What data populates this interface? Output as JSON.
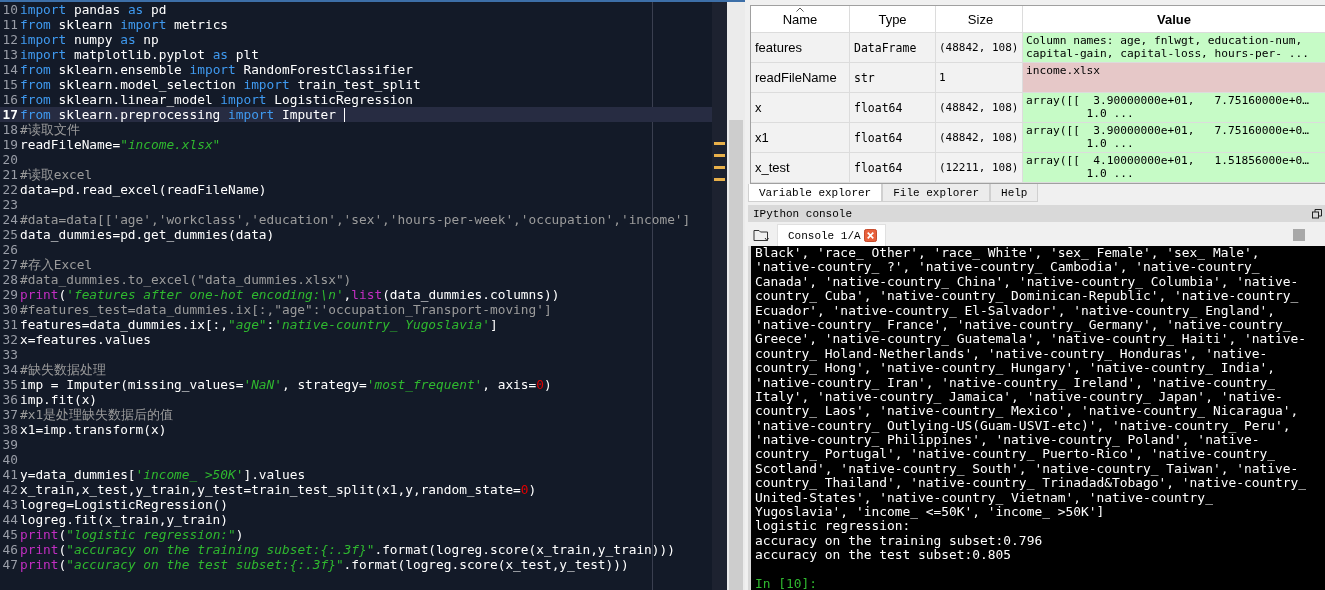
{
  "editor": {
    "lines": [
      {
        "number": "10",
        "current": false,
        "tokens": [
          {
            "kind": "keyword",
            "text": "import"
          },
          {
            "kind": "plain",
            "text": " pandas "
          },
          {
            "kind": "keyword",
            "text": "as"
          },
          {
            "kind": "plain",
            "text": " pd"
          }
        ]
      },
      {
        "number": "11",
        "current": false,
        "tokens": [
          {
            "kind": "keyword",
            "text": "from"
          },
          {
            "kind": "plain",
            "text": " sklearn "
          },
          {
            "kind": "keyword",
            "text": "import"
          },
          {
            "kind": "plain",
            "text": " metrics"
          }
        ]
      },
      {
        "number": "12",
        "current": false,
        "tokens": [
          {
            "kind": "keyword",
            "text": "import"
          },
          {
            "kind": "plain",
            "text": " numpy "
          },
          {
            "kind": "keyword",
            "text": "as"
          },
          {
            "kind": "plain",
            "text": " np"
          }
        ]
      },
      {
        "number": "13",
        "current": false,
        "tokens": [
          {
            "kind": "keyword",
            "text": "import"
          },
          {
            "kind": "plain",
            "text": " matplotlib.pyplot "
          },
          {
            "kind": "keyword",
            "text": "as"
          },
          {
            "kind": "plain",
            "text": " plt"
          }
        ]
      },
      {
        "number": "14",
        "current": false,
        "tokens": [
          {
            "kind": "keyword",
            "text": "from"
          },
          {
            "kind": "plain",
            "text": " sklearn.ensemble "
          },
          {
            "kind": "keyword",
            "text": "import"
          },
          {
            "kind": "plain",
            "text": " RandomForestClassifier"
          }
        ]
      },
      {
        "number": "15",
        "current": false,
        "tokens": [
          {
            "kind": "keyword",
            "text": "from"
          },
          {
            "kind": "plain",
            "text": " sklearn.model_selection "
          },
          {
            "kind": "keyword",
            "text": "import"
          },
          {
            "kind": "plain",
            "text": " train_test_split"
          }
        ]
      },
      {
        "number": "16",
        "current": false,
        "tokens": [
          {
            "kind": "keyword",
            "text": "from"
          },
          {
            "kind": "plain",
            "text": " sklearn.linear_model "
          },
          {
            "kind": "keyword",
            "text": "import"
          },
          {
            "kind": "plain",
            "text": " LogisticRegression"
          }
        ]
      },
      {
        "number": "17",
        "current": true,
        "tokens": [
          {
            "kind": "keyword",
            "text": "from"
          },
          {
            "kind": "plain",
            "text": " sklearn.preprocessing "
          },
          {
            "kind": "keyword",
            "text": "import"
          },
          {
            "kind": "plain",
            "text": " Imputer"
          }
        ]
      },
      {
        "number": "18",
        "current": false,
        "tokens": [
          {
            "kind": "comment",
            "text": "#读取文件"
          }
        ]
      },
      {
        "number": "19",
        "current": false,
        "tokens": [
          {
            "kind": "plain",
            "text": "readFileName="
          },
          {
            "kind": "string",
            "text": "\"income.xlsx\""
          }
        ]
      },
      {
        "number": "20",
        "current": false
      },
      {
        "number": "21",
        "current": false,
        "tokens": [
          {
            "kind": "comment",
            "text": "#读取excel"
          }
        ]
      },
      {
        "number": "22",
        "current": false,
        "tokens": [
          {
            "kind": "plain",
            "text": "data=pd.read_excel(readFileName)"
          }
        ]
      },
      {
        "number": "23",
        "current": false
      },
      {
        "number": "24",
        "current": false,
        "tokens": [
          {
            "kind": "comment",
            "text": "#data=data[['age','workclass','education','sex','hours-per-week','occupation','income']"
          }
        ]
      },
      {
        "number": "25",
        "current": false,
        "tokens": [
          {
            "kind": "plain",
            "text": "data_dummies=pd.get_dummies(data)"
          }
        ]
      },
      {
        "number": "26",
        "current": false
      },
      {
        "number": "27",
        "current": false,
        "tokens": [
          {
            "kind": "comment",
            "text": "#存入Excel"
          }
        ]
      },
      {
        "number": "28",
        "current": false,
        "tokens": [
          {
            "kind": "comment",
            "text": "#data_dummies.to_excel(\"data_dummies.xlsx\")"
          }
        ]
      },
      {
        "number": "29",
        "current": false,
        "tokens": [
          {
            "kind": "builtin",
            "text": "print"
          },
          {
            "kind": "plain",
            "text": "("
          },
          {
            "kind": "string",
            "text": "'features after one-hot encoding:\\n'"
          },
          {
            "kind": "plain",
            "text": ","
          },
          {
            "kind": "builtin",
            "text": "list"
          },
          {
            "kind": "plain",
            "text": "(data_dummies.columns))"
          }
        ]
      },
      {
        "number": "30",
        "current": false,
        "tokens": [
          {
            "kind": "comment",
            "text": "#features_test=data_dummies.ix[:,\"age\":'occupation_Transport-moving']"
          }
        ]
      },
      {
        "number": "31",
        "current": false,
        "tokens": [
          {
            "kind": "plain",
            "text": "features=data_dummies.ix[:,"
          },
          {
            "kind": "string",
            "text": "\"age\""
          },
          {
            "kind": "plain",
            "text": ":"
          },
          {
            "kind": "string",
            "text": "'native-country_ Yugoslavia'"
          },
          {
            "kind": "plain",
            "text": "]"
          }
        ]
      },
      {
        "number": "32",
        "current": false,
        "tokens": [
          {
            "kind": "plain",
            "text": "x=features.values"
          }
        ]
      },
      {
        "number": "33",
        "current": false
      },
      {
        "number": "34",
        "current": false,
        "tokens": [
          {
            "kind": "comment",
            "text": "#缺失数据处理"
          }
        ]
      },
      {
        "number": "35",
        "current": false,
        "tokens": [
          {
            "kind": "plain",
            "text": "imp = Imputer(missing_values="
          },
          {
            "kind": "string",
            "text": "'NaN'"
          },
          {
            "kind": "plain",
            "text": ", strategy="
          },
          {
            "kind": "string",
            "text": "'most_frequent'"
          },
          {
            "kind": "plain",
            "text": ", axis="
          },
          {
            "kind": "number",
            "text": "0"
          },
          {
            "kind": "plain",
            "text": ")"
          }
        ]
      },
      {
        "number": "36",
        "current": false,
        "tokens": [
          {
            "kind": "plain",
            "text": "imp.fit(x)"
          }
        ]
      },
      {
        "number": "37",
        "current": false,
        "tokens": [
          {
            "kind": "comment",
            "text": "#x1是处理缺失数据后的值"
          }
        ]
      },
      {
        "number": "38",
        "current": false,
        "tokens": [
          {
            "kind": "plain",
            "text": "x1=imp.transform(x)"
          }
        ]
      },
      {
        "number": "39",
        "current": false
      },
      {
        "number": "40",
        "current": false
      },
      {
        "number": "41",
        "current": false,
        "tokens": [
          {
            "kind": "plain",
            "text": "y=data_dummies["
          },
          {
            "kind": "string",
            "text": "'income_ >50K'"
          },
          {
            "kind": "plain",
            "text": "].values"
          }
        ]
      },
      {
        "number": "42",
        "current": false,
        "tokens": [
          {
            "kind": "plain",
            "text": "x_train,x_test,y_train,y_test=train_test_split(x1,y,random_state="
          },
          {
            "kind": "number",
            "text": "0"
          },
          {
            "kind": "plain",
            "text": ")"
          }
        ]
      },
      {
        "number": "43",
        "current": false,
        "tokens": [
          {
            "kind": "plain",
            "text": "logreg=LogisticRegression()"
          }
        ]
      },
      {
        "number": "44",
        "current": false,
        "tokens": [
          {
            "kind": "plain",
            "text": "logreg.fit(x_train,y_train)"
          }
        ]
      },
      {
        "number": "45",
        "current": false,
        "tokens": [
          {
            "kind": "builtin",
            "text": "print"
          },
          {
            "kind": "plain",
            "text": "("
          },
          {
            "kind": "string",
            "text": "\"logistic regression:\""
          },
          {
            "kind": "plain",
            "text": ")"
          }
        ]
      },
      {
        "number": "46",
        "current": false,
        "tokens": [
          {
            "kind": "builtin",
            "text": "print"
          },
          {
            "kind": "plain",
            "text": "("
          },
          {
            "kind": "string",
            "text": "\"accuracy on the training subset:{:.3f}\""
          },
          {
            "kind": "plain",
            "text": ".format(logreg.score(x_train,y_train)))"
          }
        ]
      },
      {
        "number": "47",
        "current": false,
        "tokens": [
          {
            "kind": "builtin",
            "text": "print"
          },
          {
            "kind": "plain",
            "text": "("
          },
          {
            "kind": "string",
            "text": "\"accuracy on the test subset:{:.3f}\""
          },
          {
            "kind": "plain",
            "text": ".format(logreg.score(x_test,y_test)))"
          }
        ]
      }
    ]
  },
  "variable_explorer": {
    "columns": [
      {
        "label": "Name",
        "sorted": true
      },
      {
        "label": "Type",
        "sorted": false
      },
      {
        "label": "Size",
        "sorted": false
      },
      {
        "label": "Value",
        "sorted": false
      }
    ],
    "rows": [
      {
        "name": "features",
        "type": "DataFrame",
        "size": "(48842, 108)",
        "value": [
          "Column names: age, fnlwgt, education-num,",
          "capital-gain, capital-loss, hours-per- ..."
        ],
        "color": "#c6fbc6"
      },
      {
        "name": "readFileName",
        "type": "str",
        "size": "1",
        "value": [
          "income.xlsx"
        ],
        "color": "#e6c8c8"
      },
      {
        "name": "x",
        "type": "float64",
        "size": "(48842, 108)",
        "value": [
          "array([[  3.90000000e+01,   7.75160000e+0…",
          "         1.0 ..."
        ],
        "color": "#c6fbc6"
      },
      {
        "name": "x1",
        "type": "float64",
        "size": "(48842, 108)",
        "value": [
          "array([[  3.90000000e+01,   7.75160000e+0…",
          "         1.0 ..."
        ],
        "color": "#c6fbc6"
      },
      {
        "name": "x_test",
        "type": "float64",
        "size": "(12211, 108)",
        "value": [
          "array([[  4.10000000e+01,   1.51856000e+0…",
          "         1.0 ..."
        ],
        "color": "#c6fbc6"
      }
    ]
  },
  "pane_tabs": [
    {
      "label": "Variable explorer",
      "selected": true
    },
    {
      "label": "File explorer",
      "selected": false
    },
    {
      "label": "Help",
      "selected": false
    }
  ],
  "console_pane": {
    "title": "IPython console",
    "tabs": [
      {
        "label": "Console 1/A",
        "selected": true
      }
    ],
    "lines": [
      {
        "kind": "output",
        "text": "Black', 'race_ Other', 'race_ White', 'sex_ Female', 'sex_ Male',"
      },
      {
        "kind": "output",
        "text": "'native-country_ ?', 'native-country_ Cambodia', 'native-country_"
      },
      {
        "kind": "output",
        "text": "Canada', 'native-country_ China', 'native-country_ Columbia', 'native-"
      },
      {
        "kind": "output",
        "text": "country_ Cuba', 'native-country_ Dominican-Republic', 'native-country_"
      },
      {
        "kind": "output",
        "text": "Ecuador', 'native-country_ El-Salvador', 'native-country_ England',"
      },
      {
        "kind": "output",
        "text": "'native-country_ France', 'native-country_ Germany', 'native-country_"
      },
      {
        "kind": "output",
        "text": "Greece', 'native-country_ Guatemala', 'native-country_ Haiti', 'native-"
      },
      {
        "kind": "output",
        "text": "country_ Holand-Netherlands', 'native-country_ Honduras', 'native-"
      },
      {
        "kind": "output",
        "text": "country_ Hong', 'native-country_ Hungary', 'native-country_ India',"
      },
      {
        "kind": "output",
        "text": "'native-country_ Iran', 'native-country_ Ireland', 'native-country_"
      },
      {
        "kind": "output",
        "text": "Italy', 'native-country_ Jamaica', 'native-country_ Japan', 'native-"
      },
      {
        "kind": "output",
        "text": "country_ Laos', 'native-country_ Mexico', 'native-country_ Nicaragua',"
      },
      {
        "kind": "output",
        "text": "'native-country_ Outlying-US(Guam-USVI-etc)', 'native-country_ Peru',"
      },
      {
        "kind": "output",
        "text": "'native-country_ Philippines', 'native-country_ Poland', 'native-"
      },
      {
        "kind": "output",
        "text": "country_ Portugal', 'native-country_ Puerto-Rico', 'native-country_"
      },
      {
        "kind": "output",
        "text": "Scotland', 'native-country_ South', 'native-country_ Taiwan', 'native-"
      },
      {
        "kind": "output",
        "text": "country_ Thailand', 'native-country_ Trinadad&Tobago', 'native-country_"
      },
      {
        "kind": "output",
        "text": "United-States', 'native-country_ Vietnam', 'native-country_"
      },
      {
        "kind": "output",
        "text": "Yugoslavia', 'income_ <=50K', 'income_ >50K']"
      },
      {
        "kind": "output",
        "text": "logistic regression:"
      },
      {
        "kind": "output",
        "text": "accuracy on the training subset:0.796"
      },
      {
        "kind": "output",
        "text": "accuracy on the test subset:0.805"
      },
      {
        "kind": "blank"
      },
      {
        "kind": "prompt",
        "text": "In [10]:"
      }
    ]
  }
}
